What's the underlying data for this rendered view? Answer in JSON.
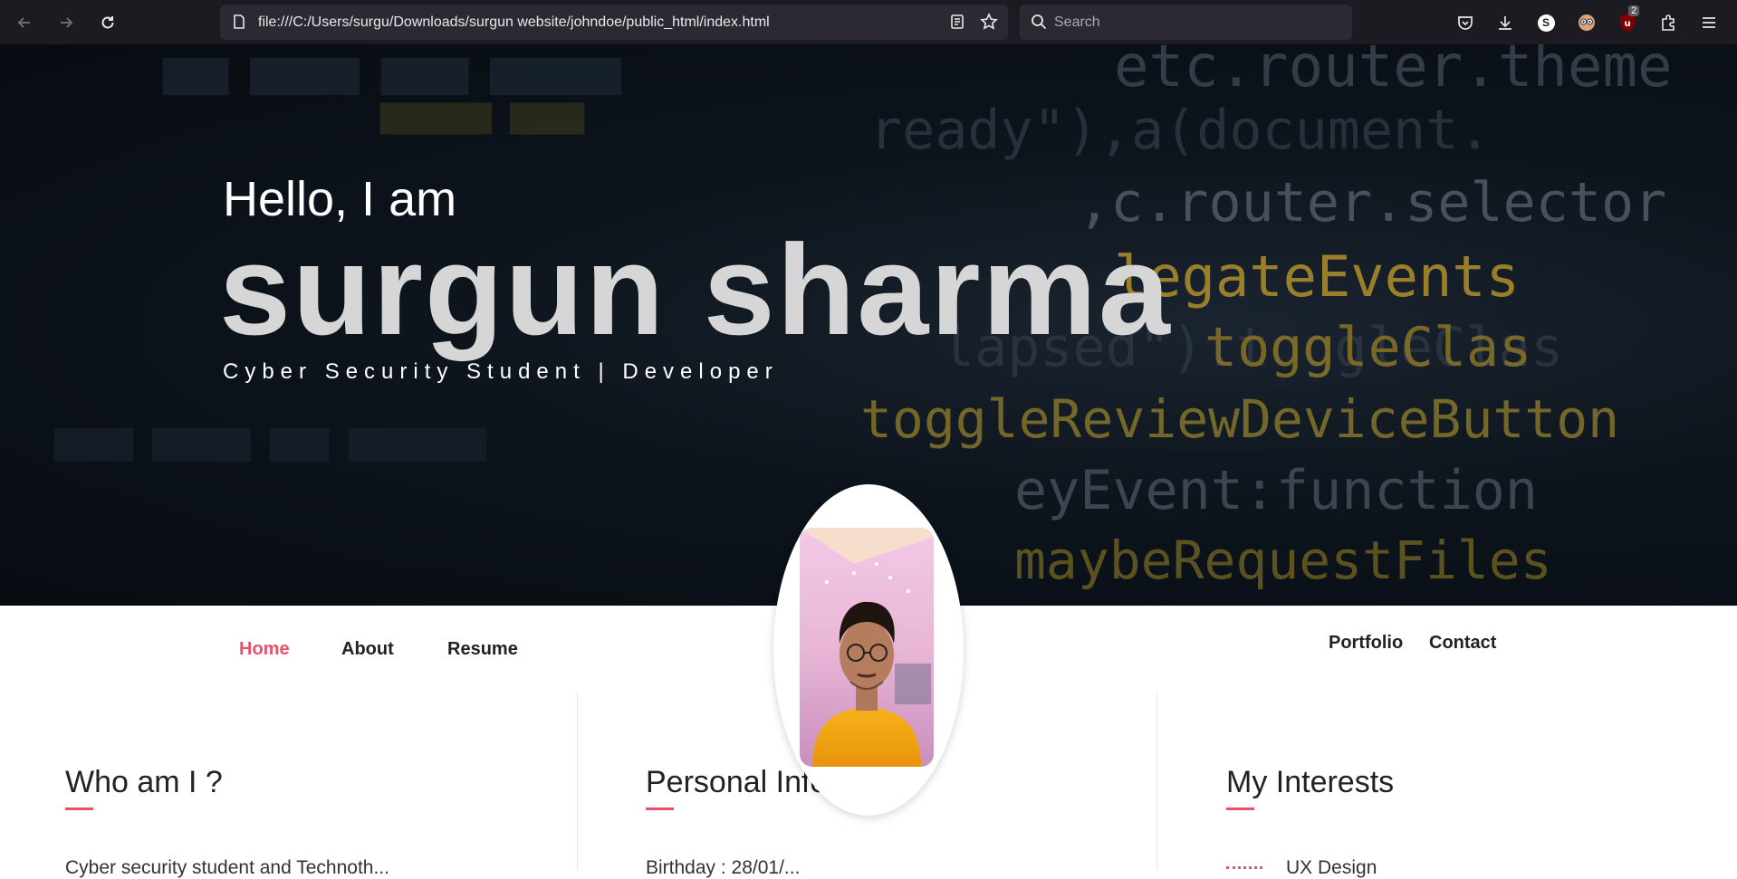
{
  "browser": {
    "url": "file:///C:/Users/surgu/Downloads/surgun website/johndoe/public_html/index.html",
    "search_placeholder": "Search",
    "extension_badge": "2",
    "profile_letter": "S"
  },
  "hero": {
    "greeting": "Hello, I am",
    "name": "surgun sharma",
    "subtitle": "Cyber Security Student | Developer"
  },
  "nav": {
    "items": [
      {
        "label": "Home",
        "active": true
      },
      {
        "label": "About"
      },
      {
        "label": "Resume"
      },
      {
        "label": "Portfolio"
      },
      {
        "label": "Contact"
      }
    ]
  },
  "sections": {
    "who": {
      "title": "Who am I ?",
      "text": "Cyber security student and Technoth..."
    },
    "personal": {
      "title": "Personal Info",
      "text": "Birthday : 28/01/..."
    },
    "interests": {
      "title": "My Interests",
      "text": "UX Design"
    }
  },
  "colors": {
    "accent": "#e9516b",
    "chrome": "#1c1b22"
  }
}
